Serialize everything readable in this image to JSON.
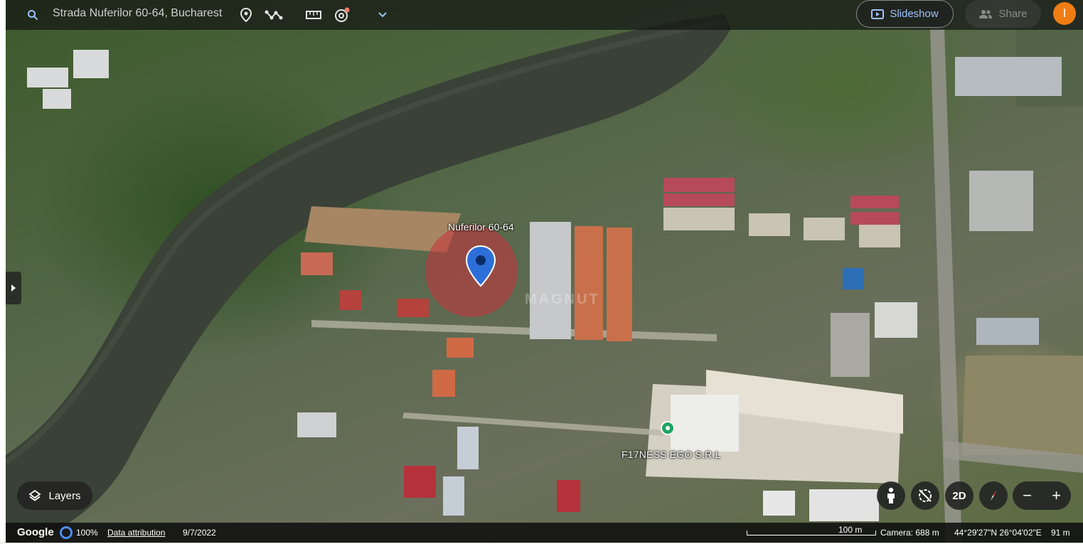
{
  "topbar": {
    "search_value": "Strada Nuferilor 60-64, Bucharest",
    "icons": [
      "search-icon",
      "location-pin-icon",
      "path-tool-icon",
      "ruler-icon",
      "timelapse-icon",
      "chevron-down-icon"
    ],
    "slideshow_label": "Slideshow",
    "share_label": "Share",
    "avatar_initial": "I",
    "accent_color": "#9ec1ff",
    "avatar_color": "#ef7d14"
  },
  "map": {
    "pin_label": "Nuferilor 60-64",
    "poi_label": "F17NESS EGO S.R.L",
    "watermark": "MAGNUT",
    "pin_color": "#2d6fd9",
    "pin_area_color": "#c8323c",
    "poi_color": "#1fa463"
  },
  "controls": {
    "layers_label": "Layers",
    "view_2d_label": "2D",
    "zoom_out_label": "−",
    "zoom_in_label": "+",
    "icons": [
      "street-view-person-icon",
      "tilt-reset-icon",
      "compass-icon",
      "layers-icon"
    ]
  },
  "status": {
    "brand": "Google",
    "load_percent": "100%",
    "data_attribution": "Data attribution",
    "imagery_date": "9/7/2022",
    "scale_label": "100 m",
    "camera": "Camera: 688 m",
    "coordinates": "44°29'27\"N 26°04'02\"E",
    "elevation": "91 m"
  }
}
